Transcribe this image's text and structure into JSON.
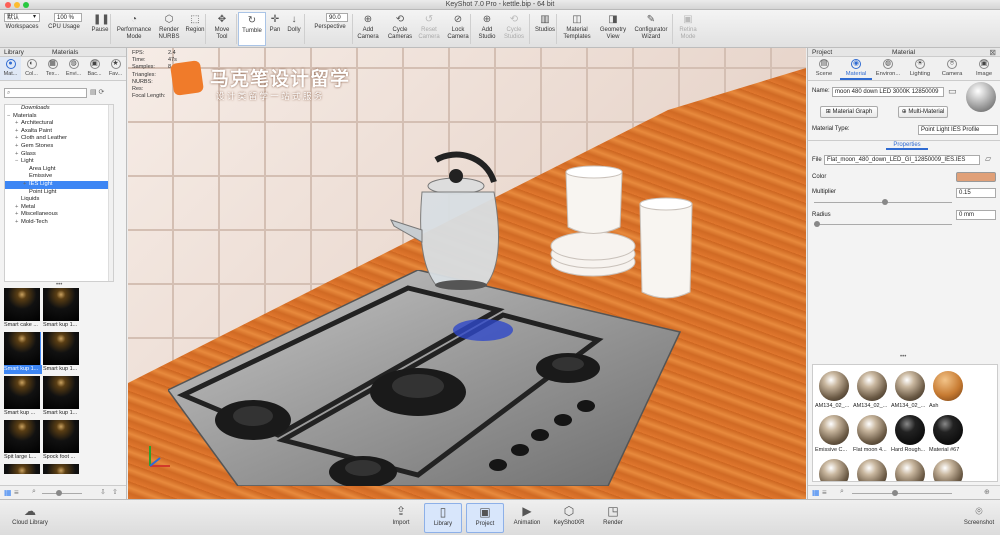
{
  "window": {
    "title": "KeyShot 7.0 Pro  - kettle.bip  - 64 bit"
  },
  "colors": {
    "accent": "#2f6bd2",
    "selection": "#3d86f4",
    "material_color": "#e0a078",
    "counter": "#e0772e"
  },
  "toolbar": {
    "workspace_select": "默认",
    "cpu_usage_value": "100 %",
    "perspective_value": "90.0",
    "items": [
      {
        "label": "Workspaces",
        "icon": "workspaces-icon"
      },
      {
        "label": "CPU Usage",
        "icon": "cpu-icon"
      },
      {
        "label": "Pause",
        "icon": "pause-icon"
      },
      {
        "label": "Performance Mode",
        "icon": "performance-icon"
      },
      {
        "label": "Render NURBS",
        "icon": "nurbs-icon"
      },
      {
        "label": "Region",
        "icon": "region-icon"
      },
      {
        "label": "Move Tool",
        "icon": "move-tool-icon"
      },
      {
        "label": "Tumble",
        "icon": "tumble-icon"
      },
      {
        "label": "Pan",
        "icon": "pan-icon"
      },
      {
        "label": "Dolly",
        "icon": "dolly-icon"
      },
      {
        "label": "Perspective",
        "icon": "perspective-icon"
      },
      {
        "label": "Add Camera",
        "icon": "add-camera-icon"
      },
      {
        "label": "Cycle Cameras",
        "icon": "cycle-cameras-icon"
      },
      {
        "label": "Reset Camera",
        "icon": "reset-camera-icon"
      },
      {
        "label": "Lock Camera",
        "icon": "lock-camera-icon"
      },
      {
        "label": "Add Studio",
        "icon": "add-studio-icon"
      },
      {
        "label": "Cycle Studios",
        "icon": "cycle-studios-icon"
      },
      {
        "label": "Studios",
        "icon": "studios-icon"
      },
      {
        "label": "Material Templates",
        "icon": "material-templates-icon"
      },
      {
        "label": "Geometry View",
        "icon": "geometry-view-icon"
      },
      {
        "label": "Configurator Wizard",
        "icon": "configurator-icon"
      },
      {
        "label": "Retina Mode",
        "icon": "retina-icon"
      }
    ]
  },
  "left_panel": {
    "header_left": "Library",
    "header_right": "Materials",
    "tabs": [
      "Mat...",
      "Col...",
      "Tex...",
      "Envi...",
      "Bac...",
      "Fav..."
    ],
    "tree": [
      {
        "label": "Downloads",
        "indent": 1,
        "pm": "",
        "italic": true
      },
      {
        "label": "Materials",
        "indent": 0,
        "pm": "−"
      },
      {
        "label": "Architectural",
        "indent": 1,
        "pm": "+"
      },
      {
        "label": "Axalta Paint",
        "indent": 1,
        "pm": "+"
      },
      {
        "label": "Cloth and Leather",
        "indent": 1,
        "pm": "+"
      },
      {
        "label": "Gem Stones",
        "indent": 1,
        "pm": "+"
      },
      {
        "label": "Glass",
        "indent": 1,
        "pm": "+"
      },
      {
        "label": "Light",
        "indent": 1,
        "pm": "−"
      },
      {
        "label": "Area Light",
        "indent": 2,
        "pm": ""
      },
      {
        "label": "Emissive",
        "indent": 2,
        "pm": ""
      },
      {
        "label": "IES Light",
        "indent": 2,
        "pm": "+",
        "selected": true
      },
      {
        "label": "Point Light",
        "indent": 2,
        "pm": ""
      },
      {
        "label": "Liquids",
        "indent": 1,
        "pm": ""
      },
      {
        "label": "Metal",
        "indent": 1,
        "pm": "+"
      },
      {
        "label": "Miscellaneous",
        "indent": 1,
        "pm": "+"
      },
      {
        "label": "Mold-Tech",
        "indent": 1,
        "pm": "+"
      }
    ],
    "thumbnails": [
      {
        "label": "Smart cake ..."
      },
      {
        "label": "Smart kup 1..."
      },
      {
        "label": "Smart kup 1...",
        "selected": true
      },
      {
        "label": "Smart kup 1..."
      },
      {
        "label": "Smart kup ..."
      },
      {
        "label": "Smart kup 1..."
      },
      {
        "label": "Spit large L..."
      },
      {
        "label": "Spock foot ..."
      },
      {
        "label": "Spock foot ..."
      },
      {
        "label": "Stove LED ..."
      }
    ]
  },
  "viewport": {
    "stats": [
      {
        "k": "FPS:",
        "v": "2.4"
      },
      {
        "k": "Time:",
        "v": "47s"
      },
      {
        "k": "Samples:",
        "v": "8"
      },
      {
        "k": "Triangles:",
        "v": ""
      },
      {
        "k": "NURBS:",
        "v": ""
      },
      {
        "k": "Res:",
        "v": ""
      },
      {
        "k": "Focal Length:",
        "v": ""
      }
    ],
    "watermark_title": "马克笔设计留学",
    "watermark_sub": "设 计 类 留 学 一 站 式 服 务"
  },
  "right_panel": {
    "header_left": "Project",
    "header_right": "Material",
    "tabs": [
      "Scene",
      "Material",
      "Environ...",
      "Lighting",
      "Camera",
      "Image"
    ],
    "name_label": "Name:",
    "name_value": "moon 480 down LED 3000K 12850009",
    "material_graph_btn": "Material Graph",
    "multi_material_btn": "Multi-Material",
    "material_type_label": "Material Type:",
    "material_type_value": "Point Light IES Profile",
    "properties_tab": "Properties",
    "file_label": "File",
    "file_value": "Flat_moon_480_down_LED_GI_12850009_IES.IES",
    "color_label": "Color",
    "multiplier_label": "Multiplier",
    "multiplier_value": "0.15",
    "radius_label": "Radius",
    "radius_value": "0 mm",
    "materials": [
      {
        "label": "AM134_02_...",
        "ball": "env"
      },
      {
        "label": "AM134_02_...",
        "ball": "env"
      },
      {
        "label": "AM134_02_...",
        "ball": "env"
      },
      {
        "label": "Ash",
        "ball": "wood"
      },
      {
        "label": "Emissive C...",
        "ball": "env"
      },
      {
        "label": "Flat moon 4...",
        "ball": "env"
      },
      {
        "label": "Hard Rough...",
        "ball": "black"
      },
      {
        "label": "Material #67",
        "ball": "black"
      },
      {
        "label": "",
        "ball": "env"
      },
      {
        "label": "",
        "ball": "env"
      },
      {
        "label": "",
        "ball": "env"
      },
      {
        "label": "",
        "ball": "env"
      }
    ]
  },
  "bottombar": {
    "cloud_library": "Cloud Library",
    "screenshot": "Screenshot",
    "items": [
      {
        "label": "Import",
        "icon": "import-icon"
      },
      {
        "label": "Library",
        "icon": "library-icon",
        "selected": true
      },
      {
        "label": "Project",
        "icon": "project-icon",
        "selected": true
      },
      {
        "label": "Animation",
        "icon": "animation-icon"
      },
      {
        "label": "KeyShotXR",
        "icon": "keyshotxr-icon"
      },
      {
        "label": "Render",
        "icon": "render-icon"
      }
    ]
  }
}
